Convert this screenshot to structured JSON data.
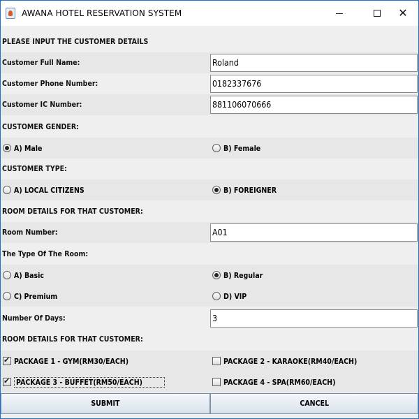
{
  "window": {
    "title": "AWANA HOTEL RESERVATION SYSTEM",
    "controls": {
      "minimize": "–",
      "maximize": "□",
      "close": "✕"
    }
  },
  "form": {
    "section_customer": "PLEASE INPUT THE CUSTOMER DETAILS",
    "full_name": {
      "label": "Customer Full Name:",
      "value": "Roland"
    },
    "phone": {
      "label": "Customer Phone Number:",
      "value": "0182337676"
    },
    "ic": {
      "label": "Customer IC Number:",
      "value": "881106070666"
    },
    "gender": {
      "label": "CUSTOMER GENDER:",
      "options": [
        {
          "label": "A) Male",
          "selected": true
        },
        {
          "label": "B) Female",
          "selected": false
        }
      ]
    },
    "type": {
      "label": "CUSTOMER TYPE:",
      "options": [
        {
          "label": "A) LOCAL CITIZENS",
          "selected": false
        },
        {
          "label": "B) FOREIGNER",
          "selected": true
        }
      ]
    },
    "section_room": "ROOM DETAILS FOR THAT CUSTOMER:",
    "room_number": {
      "label": "Room Number:",
      "value": "A01"
    },
    "room_type": {
      "label": "The Type Of The Room:",
      "options": [
        {
          "label": "A) Basic",
          "selected": false
        },
        {
          "label": "B) Regular",
          "selected": true
        },
        {
          "label": "C) Premium",
          "selected": false
        },
        {
          "label": "D) VIP",
          "selected": false
        }
      ]
    },
    "days": {
      "label": "Number Of Days:",
      "value": "3"
    },
    "section_packages": "ROOM DETAILS FOR THAT CUSTOMER:",
    "packages": [
      {
        "label": "PACKAGE 1 - GYM(RM30/EACH)",
        "checked": true
      },
      {
        "label": "PACKAGE 2 - KARAOKE(RM40/EACH)",
        "checked": false
      },
      {
        "label": "PACKAGE 3 - BUFFET(RM50/EACH)",
        "checked": true
      },
      {
        "label": "PACKAGE 4 - SPA(RM60/EACH)",
        "checked": false
      }
    ]
  },
  "buttons": {
    "submit": "SUBMIT",
    "cancel": "CANCEL"
  },
  "icons": {
    "app": "java-cup-icon"
  }
}
